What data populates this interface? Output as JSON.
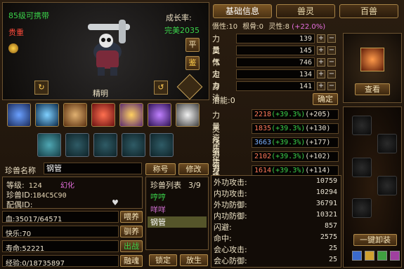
{
  "header": {
    "level_text": "85级可携带",
    "rarity": "贵重",
    "growth_label": "成长率:",
    "growth_value": "完美2035"
  },
  "pet": {
    "name_under": "精明",
    "flat_btn": "平",
    "identify_btn": "鉴"
  },
  "tabs": [
    "基础信息",
    "兽灵",
    "百兽"
  ],
  "top_stats": {
    "dun_label": "慑性:",
    "dun_value": "10",
    "gen_label": "根骨:",
    "gen_value": "0",
    "ling_label": "灵性:",
    "ling_value": "8",
    "ling_pct": "(+22.0%)"
  },
  "attrs": [
    {
      "label": "力量",
      "value": "139"
    },
    {
      "label": "灵气",
      "value": "145"
    },
    {
      "label": "体力",
      "value": "746"
    },
    {
      "label": "定力",
      "value": "134"
    },
    {
      "label": "身法",
      "value": "141"
    }
  ],
  "potential": {
    "label": "潜能:",
    "value": "0",
    "confirm": "确定"
  },
  "aptitudes": [
    {
      "label": "力量资质",
      "value": "2218",
      "pct": "(+39.3%)",
      "extra": "(+205)"
    },
    {
      "label": "灵气资质",
      "value": "1835",
      "pct": "(+39.3%)",
      "extra": "(+130)"
    },
    {
      "label": "体力资质",
      "value": "3663",
      "pct": "(+39.3%)",
      "extra": "(+177)"
    },
    {
      "label": "定力资质",
      "value": "2102",
      "pct": "(+39.3%)",
      "extra": "(+102)"
    },
    {
      "label": "身法资质",
      "value": "1614",
      "pct": "(+39.3%)",
      "extra": "(+114)"
    }
  ],
  "combat": [
    {
      "label": "外功攻击:",
      "value": "10759"
    },
    {
      "label": "内功攻击:",
      "value": "10294"
    },
    {
      "label": "外功防御:",
      "value": "36791"
    },
    {
      "label": "内功防御:",
      "value": "10321"
    },
    {
      "label": "闪避:",
      "value": "857"
    },
    {
      "label": "命中:",
      "value": "2575"
    },
    {
      "label": "会心攻击:",
      "value": "25"
    },
    {
      "label": "会心防御:",
      "value": "25"
    }
  ],
  "info": {
    "name_label": "珍兽名称",
    "name_value": "钢管",
    "title_btn": "称号",
    "modify_btn": "修改",
    "level_label": "等级:",
    "level_value": "124",
    "type_value": "幻化",
    "id_label": "珍兽ID:",
    "id_value": "1B4C5C90",
    "mate_label": "配偶ID:",
    "mate_value": ""
  },
  "list": {
    "title": "珍兽列表",
    "count": "3/9",
    "items": [
      "哼哼",
      "咩咩",
      "钢管"
    ]
  },
  "bars": [
    {
      "label": "血:",
      "value": "35017/64571",
      "btn": "喂养"
    },
    {
      "label": "快乐:",
      "value": "70",
      "btn": "驯养"
    },
    {
      "label": "寿命:",
      "value": "52221",
      "btn": "出战"
    },
    {
      "label": "经验:",
      "value": "0/18735897",
      "btn": "融魂"
    }
  ],
  "bottom": {
    "lock": "锁定",
    "release": "放生"
  },
  "equip": {
    "view_btn": "查看",
    "unequip_btn": "一键卸装"
  },
  "colors": {
    "gold": "#b08a4a",
    "green": "#3ad24a",
    "red": "#ff5a3a"
  }
}
